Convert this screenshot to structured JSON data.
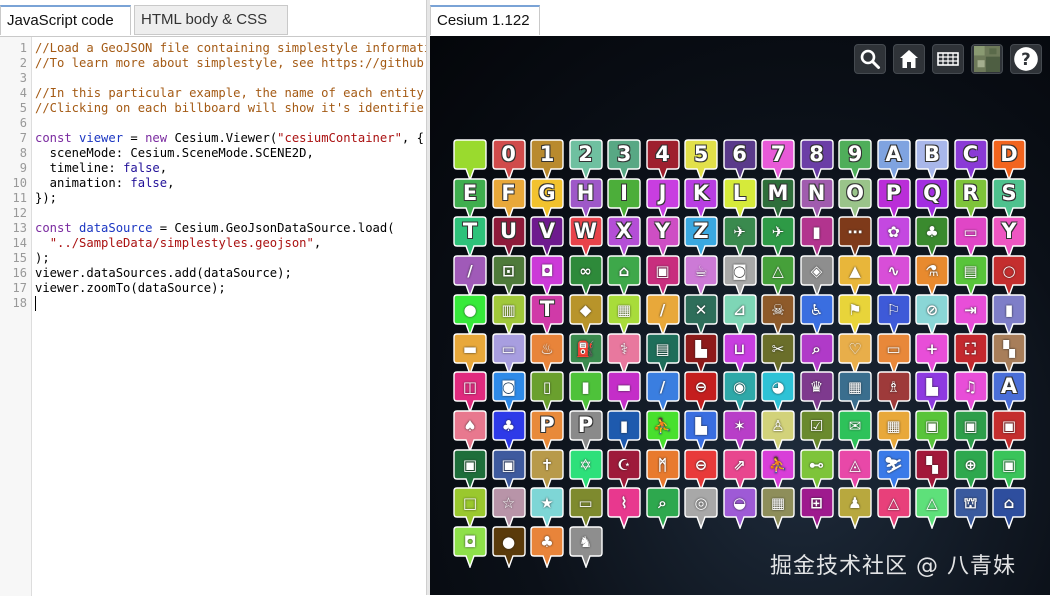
{
  "left_tabs": [
    {
      "label": "JavaScript code",
      "active": true
    },
    {
      "label": "HTML body & CSS",
      "active": false
    }
  ],
  "right_tab": {
    "label": "Cesium 1.122"
  },
  "code_lines": [
    [
      [
        "comment",
        "//Load a GeoJSON file containing simplestyle information."
      ]
    ],
    [
      [
        "comment",
        "//To learn more about simplestyle, see https://github.com/mapbox/simplestyle-spec"
      ]
    ],
    [],
    [
      [
        "comment",
        "//In this particular example, the name of each entity is set to its maki icon identifier."
      ]
    ],
    [
      [
        "comment",
        "//Clicking on each billboard will show it's identifier in the InfoBox."
      ]
    ],
    [],
    [
      [
        "keyword",
        "const "
      ],
      [
        "def",
        "viewer"
      ],
      [
        "plain",
        " = "
      ],
      [
        "keyword",
        "new "
      ],
      [
        "plain",
        "Cesium.Viewer("
      ],
      [
        "string",
        "\"cesiumContainer\""
      ],
      [
        "plain",
        ", {"
      ]
    ],
    [
      [
        "plain",
        "  sceneMode: Cesium.SceneMode.SCENE2D,"
      ]
    ],
    [
      [
        "plain",
        "  timeline: "
      ],
      [
        "atom",
        "false"
      ],
      [
        "plain",
        ","
      ]
    ],
    [
      [
        "plain",
        "  animation: "
      ],
      [
        "atom",
        "false"
      ],
      [
        "plain",
        ","
      ]
    ],
    [
      [
        "plain",
        "});"
      ]
    ],
    [],
    [
      [
        "keyword",
        "const "
      ],
      [
        "def",
        "dataSource"
      ],
      [
        "plain",
        " = Cesium.GeoJsonDataSource.load("
      ]
    ],
    [
      [
        "plain",
        "  "
      ],
      [
        "string",
        "\"../SampleData/simplestyles.geojson\""
      ],
      [
        "plain",
        ","
      ]
    ],
    [
      [
        "plain",
        ");"
      ]
    ],
    [
      [
        "plain",
        "viewer.dataSources.add(dataSource);"
      ]
    ],
    [
      [
        "plain",
        "viewer.zoomTo(dataSource);"
      ]
    ],
    []
  ],
  "line_numbers": [
    "1",
    "2",
    "3",
    "4",
    "5",
    "6",
    "7",
    "8",
    "9",
    "10",
    "11",
    "12",
    "13",
    "14",
    "15",
    "16",
    "17",
    "18"
  ],
  "toolbar": [
    {
      "name": "geocoder-search-button",
      "icon": "search-icon"
    },
    {
      "name": "home-button",
      "icon": "home-icon"
    },
    {
      "name": "scene-mode-button",
      "icon": "grid-2d-icon"
    },
    {
      "name": "base-layer-picker-button",
      "icon": "imagery-thumbnail-icon"
    },
    {
      "name": "navigation-help-button",
      "icon": "help-icon"
    }
  ],
  "markers": [
    [
      "#9ada2e",
      ""
    ],
    [
      "#d04b4b",
      "0"
    ],
    [
      "#b98a2e",
      "1"
    ],
    [
      "#6fc0a0",
      "2"
    ],
    [
      "#58a884",
      "3"
    ],
    [
      "#9e1f2e",
      "4"
    ],
    [
      "#e2e04a",
      "5"
    ],
    [
      "#5a3a8a",
      "6"
    ],
    [
      "#e85ad8",
      "7"
    ],
    [
      "#6b3ea6",
      "8"
    ],
    [
      "#4fae5a",
      "9"
    ],
    [
      "#7fa3e0",
      "A"
    ],
    [
      "#a9b7ea",
      "B"
    ],
    [
      "#8a3ad6",
      "C"
    ],
    [
      "#f2641e",
      "D"
    ],
    [
      "#3fae4e",
      "E"
    ],
    [
      "#e8a83a",
      "F"
    ],
    [
      "#f2c22e",
      "G"
    ],
    [
      "#9e58c8",
      "H"
    ],
    [
      "#4cae3a",
      "I"
    ],
    [
      "#c83ee0",
      "J"
    ],
    [
      "#b83ee2",
      "K"
    ],
    [
      "#d6ea3a",
      "L"
    ],
    [
      "#2e6e3a",
      "M"
    ],
    [
      "#a05cae",
      "N"
    ],
    [
      "#9ac48a",
      "O"
    ],
    [
      "#ba2ed8",
      "P"
    ],
    [
      "#a22ee0",
      "Q"
    ],
    [
      "#7ec43a",
      "R"
    ],
    [
      "#4ec28e",
      "S"
    ],
    [
      "#2ec27a",
      "T"
    ],
    [
      "#8e1a3a",
      "U"
    ],
    [
      "#6e1a8e",
      "V"
    ],
    [
      "#e8424a",
      "W"
    ],
    [
      "#b44ed6",
      "X"
    ],
    [
      "#ce4ec4",
      "Y"
    ],
    [
      "#3aa8e0",
      "Z"
    ],
    [
      "#3a8a4e",
      "✈"
    ],
    [
      "#2e9a46",
      "✈"
    ],
    [
      "#b2348e",
      "▮"
    ],
    [
      "#7e3a1a",
      "⋯"
    ],
    [
      "#c448e0",
      "✿"
    ],
    [
      "#3a8a2e",
      "♣"
    ],
    [
      "#e046c6",
      "▭"
    ],
    [
      "#ee56c2",
      "Y"
    ],
    [
      "#a05ab8",
      "/"
    ],
    [
      "#4e7a3a",
      "⊡"
    ],
    [
      "#cc3ad8",
      "◘"
    ],
    [
      "#2e8a3a",
      "∞"
    ],
    [
      "#3ea84a",
      "⌂"
    ],
    [
      "#c82e7e",
      "▣"
    ],
    [
      "#cc7ad6",
      "☕"
    ],
    [
      "#a8a8a8",
      "◙"
    ],
    [
      "#46a03a",
      "△"
    ],
    [
      "#8e8e8e",
      "◈"
    ],
    [
      "#e8b63a",
      "▲"
    ],
    [
      "#d84ed8",
      "∿"
    ],
    [
      "#e88a2e",
      "⚗"
    ],
    [
      "#58c43a",
      "▤"
    ],
    [
      "#c42e2e",
      "○"
    ],
    [
      "#36ea3a",
      "●"
    ],
    [
      "#a0c83a",
      "▥"
    ],
    [
      "#d03aa8",
      "T"
    ],
    [
      "#b8942a",
      "◆"
    ],
    [
      "#a8dc3a",
      "▦"
    ],
    [
      "#e8a83a",
      "/"
    ],
    [
      "#2e6e5a",
      "✕"
    ],
    [
      "#7ed6b6",
      "⊿"
    ],
    [
      "#8e5a2a",
      "☠"
    ],
    [
      "#3a6ee0",
      "♿"
    ],
    [
      "#e8d43a",
      "⚑"
    ],
    [
      "#3e5ad8",
      "⚐"
    ],
    [
      "#8ad6d6",
      "⊘"
    ],
    [
      "#e84ed8",
      "⇥"
    ],
    [
      "#7e7ec8",
      "▮"
    ],
    [
      "#e8a83a",
      "▬"
    ],
    [
      "#a89ee0",
      "▭"
    ],
    [
      "#e8843a",
      "♨"
    ],
    [
      "#3a8a4e",
      "⛽"
    ],
    [
      "#e8789e",
      "⚕"
    ],
    [
      "#1e6e5a",
      "▤"
    ],
    [
      "#8e1a1a",
      "▙"
    ],
    [
      "#c83ee0",
      "⊔"
    ],
    [
      "#6a6e2a",
      "✂"
    ],
    [
      "#b03ac8",
      "⌕"
    ],
    [
      "#e8ae4a",
      "♡"
    ],
    [
      "#e8883a",
      "▭"
    ],
    [
      "#e84ed8",
      "+"
    ],
    [
      "#c4282e",
      "⛶"
    ],
    [
      "#a87e5a",
      "▚"
    ],
    [
      "#e02a7e",
      "◫"
    ],
    [
      "#2e8ae8",
      "◙"
    ],
    [
      "#6aa02e",
      "▯"
    ],
    [
      "#4ec23a",
      "▮"
    ],
    [
      "#c42ec8",
      "▬"
    ],
    [
      "#3a7ee0",
      "/"
    ],
    [
      "#c41e1e",
      "⊖"
    ],
    [
      "#2ea8a8",
      "◉"
    ],
    [
      "#2ec2d6",
      "◕"
    ],
    [
      "#7e3a8e",
      "♛"
    ],
    [
      "#3a6e8e",
      "▦"
    ],
    [
      "#9e3a3a",
      "♗"
    ],
    [
      "#8e3ae0",
      "▙"
    ],
    [
      "#e84ed8",
      "♫"
    ],
    [
      "#4a6ed8",
      "A"
    ],
    [
      "#e8788e",
      "♠"
    ],
    [
      "#2e3ae8",
      "♣"
    ],
    [
      "#e88a3a",
      "P"
    ],
    [
      "#8a8a8a",
      "P"
    ],
    [
      "#1e5aae",
      "▮"
    ],
    [
      "#48e02e",
      "⛹"
    ],
    [
      "#3a6ee0",
      "▙"
    ],
    [
      "#b83ec8",
      "✶"
    ],
    [
      "#d2d27a",
      "♙"
    ],
    [
      "#6a8a2e",
      "☑"
    ],
    [
      "#2ec25a",
      "✉"
    ],
    [
      "#e8a83a",
      "▦"
    ],
    [
      "#58c43a",
      "▣"
    ],
    [
      "#2e9e4a",
      "▣"
    ],
    [
      "#c42e2e",
      "▣"
    ],
    [
      "#1e6e3a",
      "▣"
    ],
    [
      "#3e5a9e",
      "▣"
    ],
    [
      "#b89a4a",
      "✝"
    ],
    [
      "#2ee07a",
      "✡"
    ],
    [
      "#9e1a3a",
      "☪"
    ],
    [
      "#e87a2e",
      "ᛗ"
    ],
    [
      "#e83a3a",
      "⊖"
    ],
    [
      "#e8468e",
      "⇗"
    ],
    [
      "#d83ed8",
      "⛹"
    ],
    [
      "#7ec43a",
      "⊷"
    ],
    [
      "#e848a8",
      "◬"
    ],
    [
      "#3a7ae8",
      "⛷"
    ],
    [
      "#a2183a",
      "▚"
    ],
    [
      "#2ea84e",
      "⊕"
    ],
    [
      "#3ac45a",
      "▣"
    ],
    [
      "#9ac82e",
      "□"
    ],
    [
      "#b894a8",
      "☆"
    ],
    [
      "#7ed6d6",
      "★"
    ],
    [
      "#7e8a2e",
      "▭"
    ],
    [
      "#e8388e",
      "⌇"
    ],
    [
      "#2ea84e",
      "⌕"
    ],
    [
      "#a8a8a8",
      "◎"
    ],
    [
      "#9e5ad6",
      "◒"
    ],
    [
      "#8e8e5a",
      "▦"
    ],
    [
      "#9e1a8e",
      "⊞"
    ],
    [
      "#b8a83e",
      "♟"
    ],
    [
      "#e8407a",
      "△"
    ],
    [
      "#5ee07a",
      "△"
    ],
    [
      "#3a5a9e",
      "⛫"
    ],
    [
      "#2e4e9e",
      "⌂"
    ],
    [
      "#8ee04a",
      "◘"
    ],
    [
      "#5a3a0a",
      "●"
    ],
    [
      "#e8843a",
      "♣"
    ],
    [
      "#8e8e8e",
      "♞"
    ]
  ],
  "watermark": "掘金技术社区 @ 八青妹"
}
